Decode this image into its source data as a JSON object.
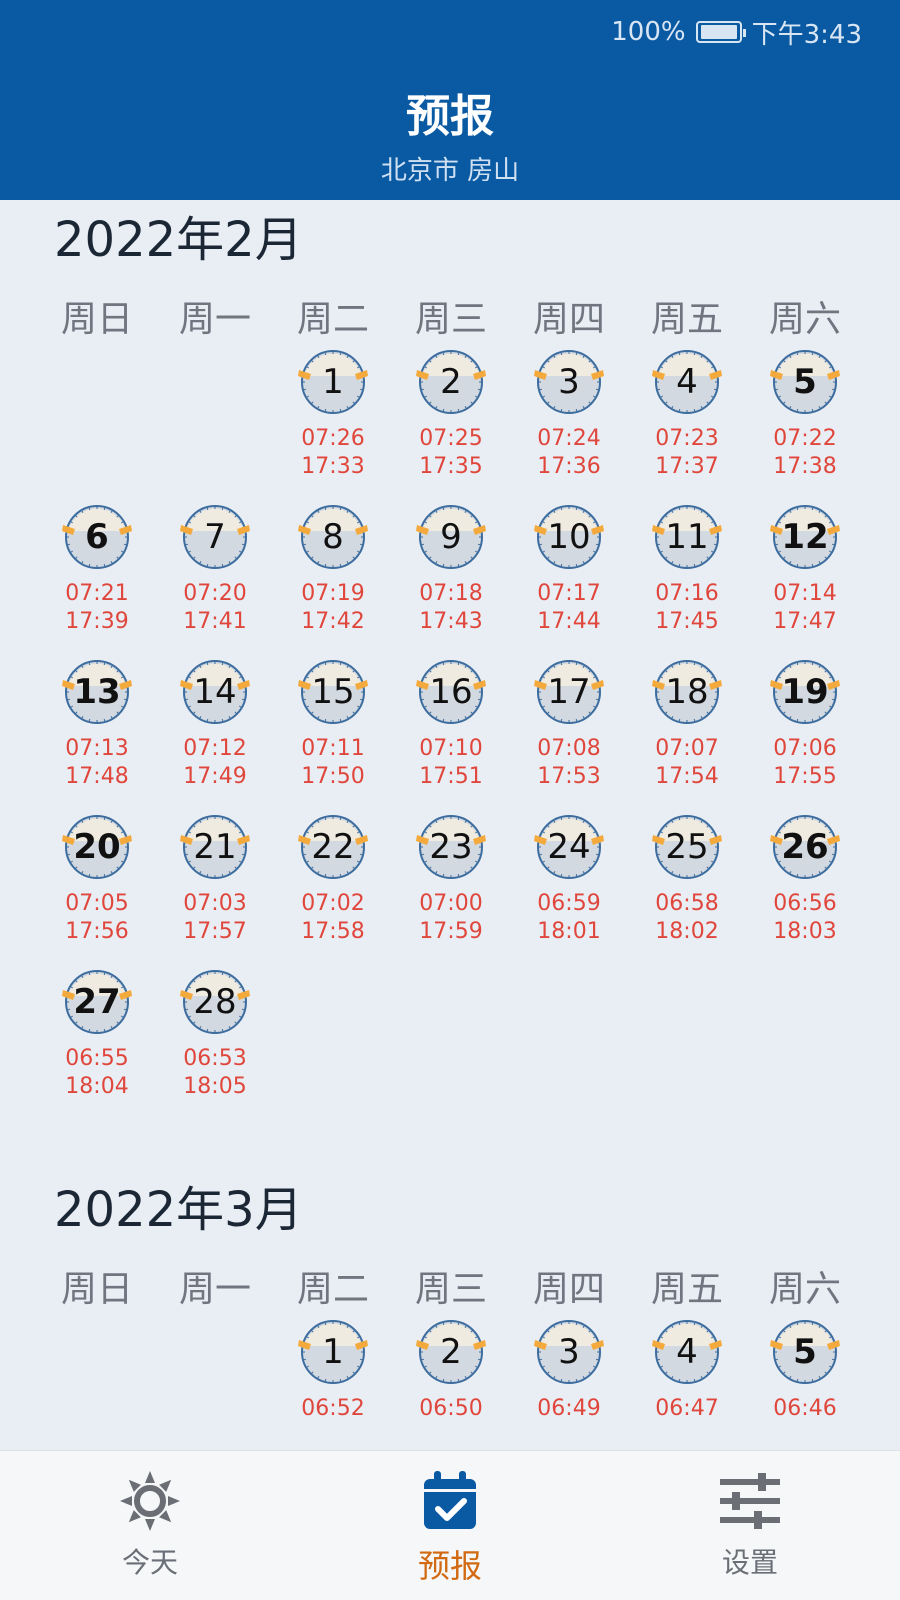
{
  "status": {
    "battery": "100%",
    "time": "下午3:43"
  },
  "header": {
    "title": "预报",
    "subtitle": "北京市 房山"
  },
  "weekdays": [
    "周日",
    "周一",
    "周二",
    "周三",
    "周四",
    "周五",
    "周六"
  ],
  "months": [
    {
      "title": "2022年2月",
      "days": [
        {
          "d": "1",
          "col": 2,
          "row": 0,
          "rise": "07:26",
          "set": "17:33"
        },
        {
          "d": "2",
          "col": 3,
          "row": 0,
          "rise": "07:25",
          "set": "17:35"
        },
        {
          "d": "3",
          "col": 4,
          "row": 0,
          "rise": "07:24",
          "set": "17:36"
        },
        {
          "d": "4",
          "col": 5,
          "row": 0,
          "rise": "07:23",
          "set": "17:37"
        },
        {
          "d": "5",
          "col": 6,
          "row": 0,
          "rise": "07:22",
          "set": "17:38"
        },
        {
          "d": "6",
          "col": 0,
          "row": 1,
          "rise": "07:21",
          "set": "17:39"
        },
        {
          "d": "7",
          "col": 1,
          "row": 1,
          "rise": "07:20",
          "set": "17:41"
        },
        {
          "d": "8",
          "col": 2,
          "row": 1,
          "rise": "07:19",
          "set": "17:42"
        },
        {
          "d": "9",
          "col": 3,
          "row": 1,
          "rise": "07:18",
          "set": "17:43"
        },
        {
          "d": "10",
          "col": 4,
          "row": 1,
          "rise": "07:17",
          "set": "17:44"
        },
        {
          "d": "11",
          "col": 5,
          "row": 1,
          "rise": "07:16",
          "set": "17:45"
        },
        {
          "d": "12",
          "col": 6,
          "row": 1,
          "rise": "07:14",
          "set": "17:47"
        },
        {
          "d": "13",
          "col": 0,
          "row": 2,
          "rise": "07:13",
          "set": "17:48"
        },
        {
          "d": "14",
          "col": 1,
          "row": 2,
          "rise": "07:12",
          "set": "17:49"
        },
        {
          "d": "15",
          "col": 2,
          "row": 2,
          "rise": "07:11",
          "set": "17:50"
        },
        {
          "d": "16",
          "col": 3,
          "row": 2,
          "rise": "07:10",
          "set": "17:51"
        },
        {
          "d": "17",
          "col": 4,
          "row": 2,
          "rise": "07:08",
          "set": "17:53"
        },
        {
          "d": "18",
          "col": 5,
          "row": 2,
          "rise": "07:07",
          "set": "17:54"
        },
        {
          "d": "19",
          "col": 6,
          "row": 2,
          "rise": "07:06",
          "set": "17:55"
        },
        {
          "d": "20",
          "col": 0,
          "row": 3,
          "rise": "07:05",
          "set": "17:56"
        },
        {
          "d": "21",
          "col": 1,
          "row": 3,
          "rise": "07:03",
          "set": "17:57"
        },
        {
          "d": "22",
          "col": 2,
          "row": 3,
          "rise": "07:02",
          "set": "17:58"
        },
        {
          "d": "23",
          "col": 3,
          "row": 3,
          "rise": "07:00",
          "set": "17:59"
        },
        {
          "d": "24",
          "col": 4,
          "row": 3,
          "rise": "06:59",
          "set": "18:01"
        },
        {
          "d": "25",
          "col": 5,
          "row": 3,
          "rise": "06:58",
          "set": "18:02"
        },
        {
          "d": "26",
          "col": 6,
          "row": 3,
          "rise": "06:56",
          "set": "18:03"
        },
        {
          "d": "27",
          "col": 0,
          "row": 4,
          "rise": "06:55",
          "set": "18:04"
        },
        {
          "d": "28",
          "col": 1,
          "row": 4,
          "rise": "06:53",
          "set": "18:05"
        }
      ]
    },
    {
      "title": "2022年3月",
      "days": [
        {
          "d": "1",
          "col": 2,
          "row": 0,
          "rise": "06:52",
          "set": ""
        },
        {
          "d": "2",
          "col": 3,
          "row": 0,
          "rise": "06:50",
          "set": ""
        },
        {
          "d": "3",
          "col": 4,
          "row": 0,
          "rise": "06:49",
          "set": ""
        },
        {
          "d": "4",
          "col": 5,
          "row": 0,
          "rise": "06:47",
          "set": ""
        },
        {
          "d": "5",
          "col": 6,
          "row": 0,
          "rise": "06:46",
          "set": ""
        }
      ]
    }
  ],
  "nav": [
    {
      "label": "今天",
      "icon": "sun-icon",
      "active": false
    },
    {
      "label": "预报",
      "icon": "calendar-check-icon",
      "active": true
    },
    {
      "label": "设置",
      "icon": "sliders-icon",
      "active": false
    }
  ],
  "colors": {
    "header": "#0a5aa3",
    "time": "#e0473c",
    "active": "#d16a12",
    "dial_face": "#d3d9e1",
    "dial_arc": "#f0ebe0",
    "dial_marker": "#f3a93b"
  }
}
